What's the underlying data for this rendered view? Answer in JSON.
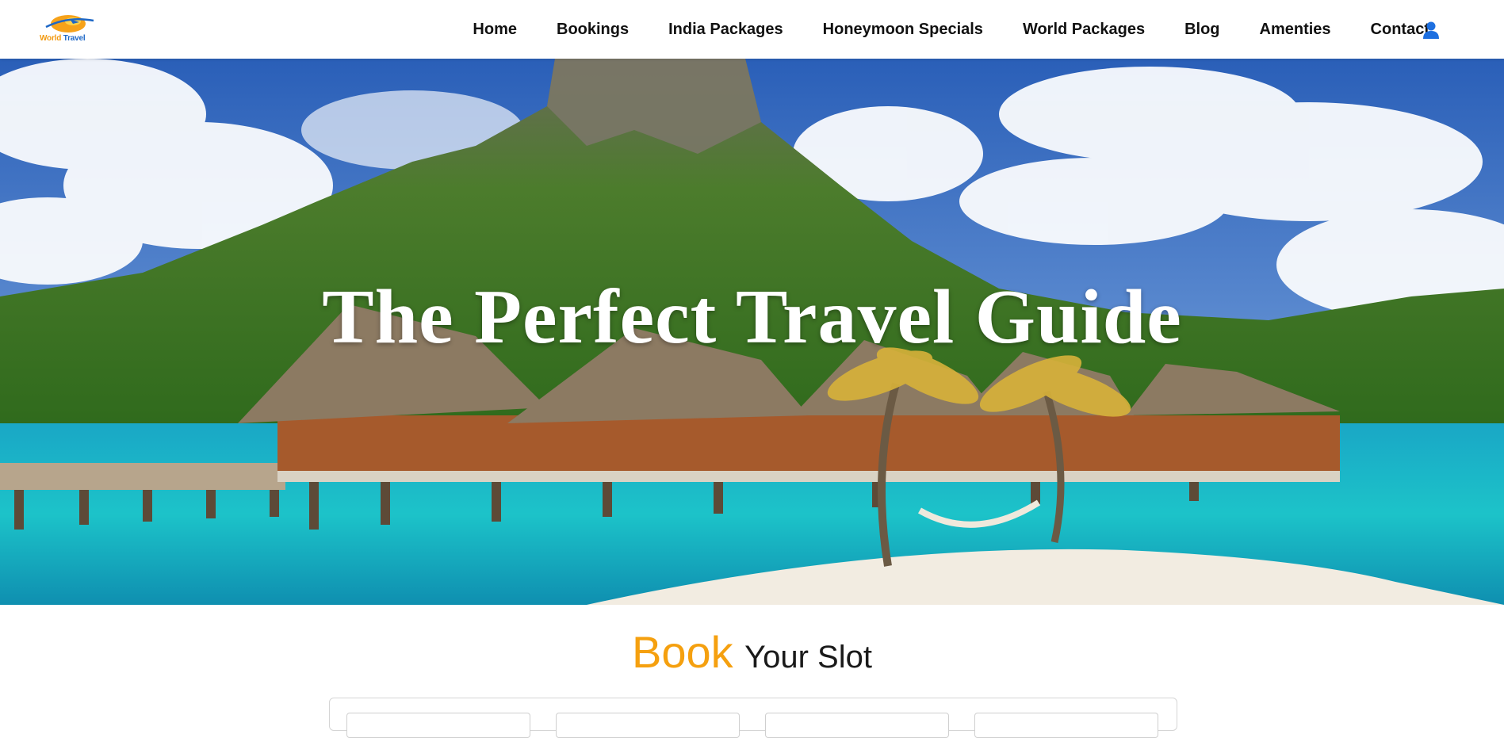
{
  "brand": {
    "logo_text_1": "World",
    "logo_text_2": "Travel"
  },
  "nav": {
    "links": [
      "Home",
      "Bookings",
      "India Packages",
      "Honeymoon Specials",
      "World Packages",
      "Blog",
      "Amenties",
      "Contact"
    ],
    "user_icon": "user-icon"
  },
  "hero": {
    "title": "The Perfect Travel Guide"
  },
  "book": {
    "accent": "Book",
    "rest": "Your Slot"
  },
  "colors": {
    "accent": "#f5a00f",
    "user_icon": "#1d6fe0",
    "logo_blue": "#1d67c6",
    "logo_orange": "#f29a12"
  }
}
